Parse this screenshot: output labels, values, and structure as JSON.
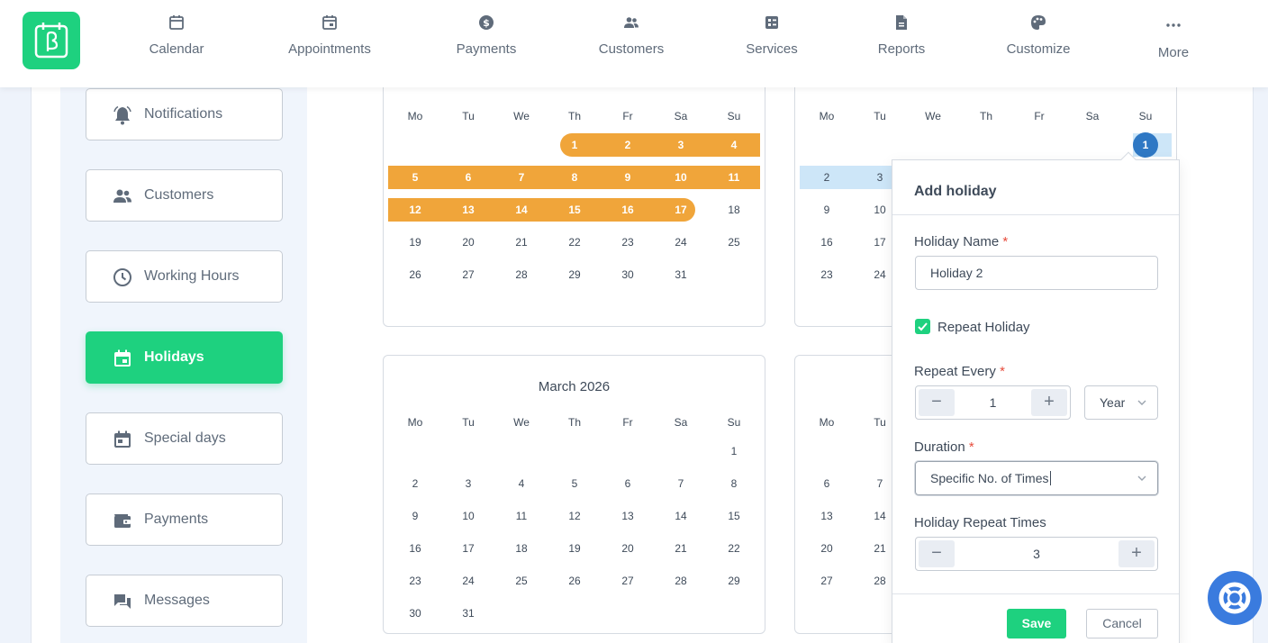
{
  "nav": {
    "items": [
      {
        "label": "Calendar",
        "icon": "calendar-icon"
      },
      {
        "label": "Appointments",
        "icon": "appointments-icon"
      },
      {
        "label": "Payments",
        "icon": "dollar-icon"
      },
      {
        "label": "Customers",
        "icon": "users-icon"
      },
      {
        "label": "Services",
        "icon": "services-icon"
      },
      {
        "label": "Reports",
        "icon": "report-icon"
      },
      {
        "label": "Customize",
        "icon": "palette-icon"
      },
      {
        "label": "More",
        "icon": "more-icon"
      }
    ]
  },
  "sidebar": {
    "items": [
      {
        "label": "Notifications",
        "icon": "bell-icon"
      },
      {
        "label": "Customers",
        "icon": "users-icon"
      },
      {
        "label": "Working Hours",
        "icon": "clock-icon"
      },
      {
        "label": "Holidays",
        "icon": "calendar-icon",
        "active": true
      },
      {
        "label": "Special days",
        "icon": "calendar-icon"
      },
      {
        "label": "Payments",
        "icon": "wallet-icon"
      },
      {
        "label": "Messages",
        "icon": "chat-icon"
      }
    ]
  },
  "calendars": {
    "weekdays": [
      "Mo",
      "Tu",
      "We",
      "Th",
      "Fr",
      "Sa",
      "Su"
    ],
    "top_left": {
      "rows": [
        [
          "",
          "",
          "",
          "1",
          "2",
          "3",
          "4"
        ],
        [
          "5",
          "6",
          "7",
          "8",
          "9",
          "10",
          "11"
        ],
        [
          "12",
          "13",
          "14",
          "15",
          "16",
          "17",
          "18"
        ],
        [
          "19",
          "20",
          "21",
          "22",
          "23",
          "24",
          "25"
        ],
        [
          "26",
          "27",
          "28",
          "29",
          "30",
          "31",
          ""
        ]
      ],
      "holiday_days": [
        "1",
        "2",
        "3",
        "4",
        "5",
        "6",
        "7",
        "8",
        "9",
        "10",
        "11",
        "12",
        "13",
        "14",
        "15",
        "16",
        "17"
      ]
    },
    "top_right": {
      "visible_days": [
        [
          "",
          "",
          "",
          "",
          "",
          "",
          "1"
        ],
        [
          "2",
          "3"
        ],
        [
          "9",
          "10"
        ],
        [
          "16",
          "17"
        ],
        [
          "23",
          "24"
        ]
      ],
      "selected_day": "1"
    },
    "march": {
      "title": "March 2026",
      "rows": [
        [
          "",
          "",
          "",
          "",
          "",
          "",
          "1"
        ],
        [
          "2",
          "3",
          "4",
          "5",
          "6",
          "7",
          "8"
        ],
        [
          "9",
          "10",
          "11",
          "12",
          "13",
          "14",
          "15"
        ],
        [
          "16",
          "17",
          "18",
          "19",
          "20",
          "21",
          "22"
        ],
        [
          "23",
          "24",
          "25",
          "26",
          "27",
          "28",
          "29"
        ],
        [
          "30",
          "31",
          "",
          "",
          "",
          "",
          ""
        ]
      ]
    },
    "bottom_right": {
      "visible_days": [
        [
          "6",
          "7"
        ],
        [
          "13",
          "14"
        ],
        [
          "20",
          "21"
        ],
        [
          "27",
          "28"
        ]
      ]
    }
  },
  "popup": {
    "title": "Add holiday",
    "holiday_name_label": "Holiday Name",
    "holiday_name_value": "Holiday 2",
    "repeat_holiday_label": "Repeat Holiday",
    "repeat_holiday_checked": true,
    "repeat_every_label": "Repeat Every",
    "repeat_every_value": "1",
    "repeat_unit": "Year",
    "duration_label": "Duration",
    "duration_value": "Specific No. of Times",
    "repeat_times_label": "Holiday Repeat Times",
    "repeat_times_value": "3",
    "save_label": "Save",
    "cancel_label": "Cancel",
    "required_mark": "*"
  },
  "colors": {
    "brand_green": "#1ed17f",
    "holiday_orange": "#f0a53a",
    "selected_blue": "#2f78c4",
    "range_blue": "#cde6f8"
  }
}
